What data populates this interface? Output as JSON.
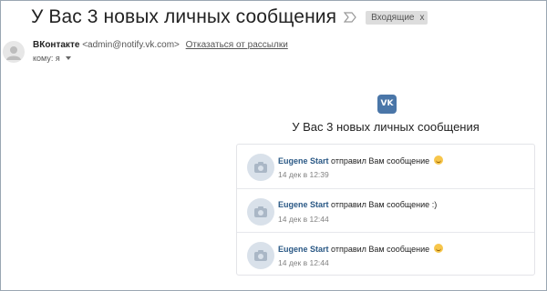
{
  "email": {
    "subject": "У Вас 3 новых личных сообщения",
    "label": "Входящие",
    "label_close": "x",
    "sender_name": "ВКонтакте",
    "sender_email": "<admin@notify.vk.com>",
    "unsubscribe": "Отказаться от рассылки",
    "to": "кому: я"
  },
  "body": {
    "logo_text": "VK",
    "title": "У Вас 3 новых личных сообщения",
    "messages": [
      {
        "author": "Eugene Start",
        "text": "отправил Вам сообщение",
        "suffix": "",
        "emoji": true,
        "time": "14 дек в 12:39"
      },
      {
        "author": "Eugene Start",
        "text": "отправил Вам сообщение",
        "suffix": ":)",
        "emoji": false,
        "time": "14 дек в 12:44"
      },
      {
        "author": "Eugene Start",
        "text": "отправил Вам сообщение",
        "suffix": "",
        "emoji": true,
        "time": "14 дек в 12:44"
      }
    ]
  },
  "colors": {
    "vk_blue": "#4a76a8",
    "author_link": "#2a5885",
    "label_bg": "#dddddd"
  }
}
